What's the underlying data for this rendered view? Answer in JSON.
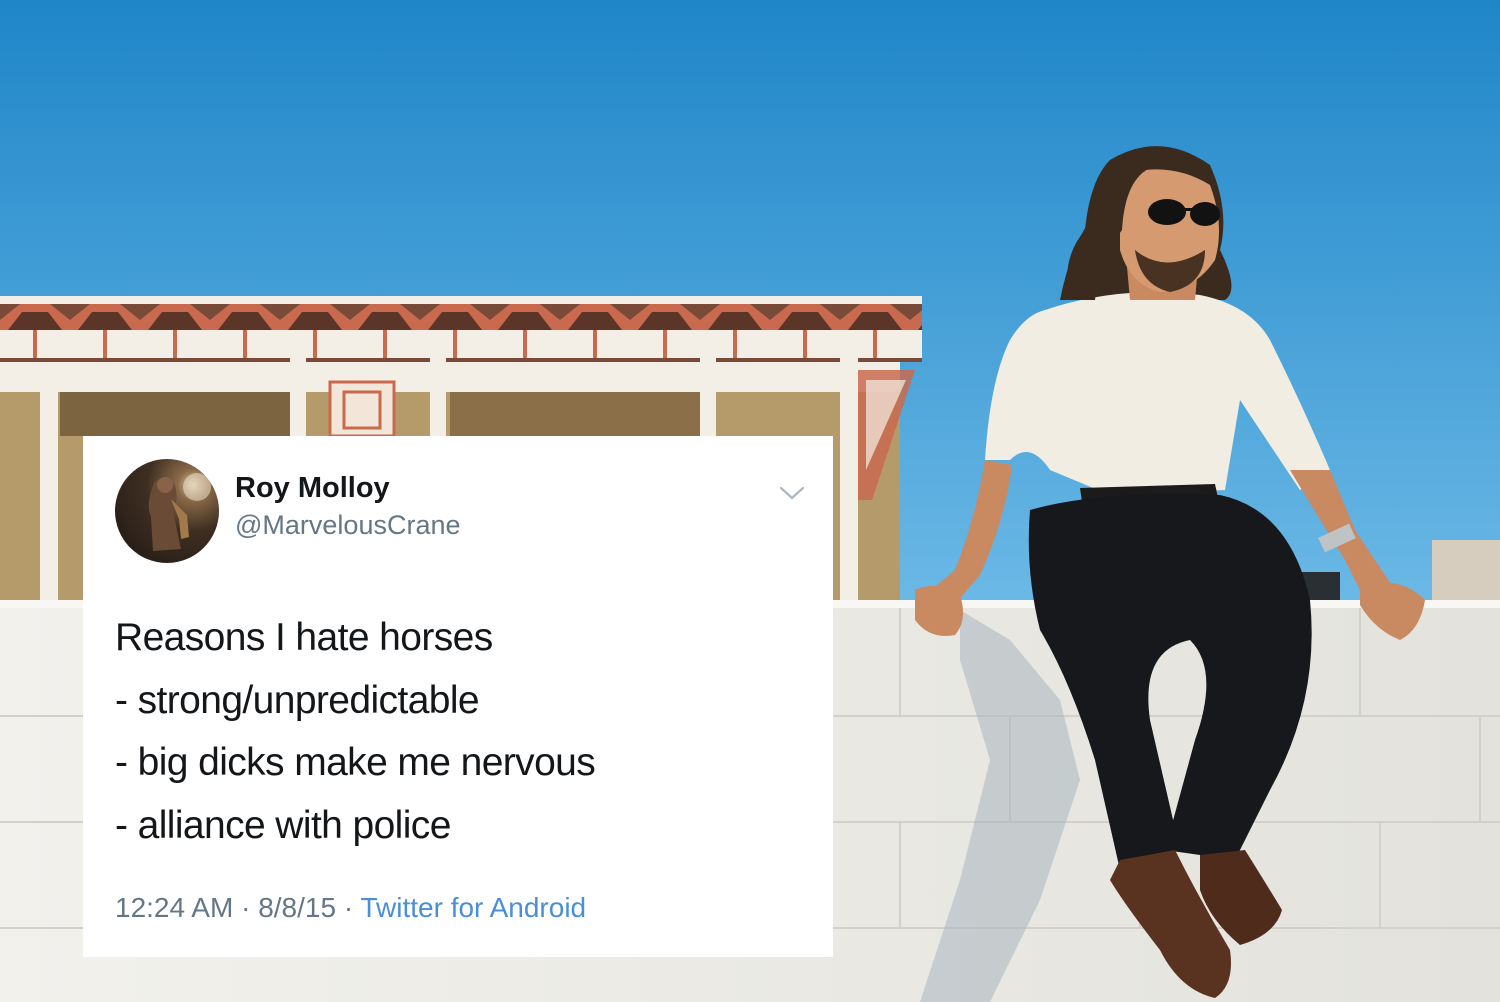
{
  "tweet": {
    "display_name": "Roy Molloy",
    "handle": "@MarvelousCrane",
    "lines": [
      "Reasons I hate horses",
      "- strong/unpredictable",
      "- big dicks make me nervous",
      "- alliance with police"
    ],
    "time": "12:24 AM",
    "date": "8/8/15",
    "separator": "·",
    "source": "Twitter for Android",
    "menu_icon": "chevron-down-icon",
    "avatar_icon": "profile-photo"
  },
  "colors": {
    "sky_top": "#1f86c8",
    "sky_bottom": "#66b6e4",
    "wall": "#ecebe6",
    "building_trim": "#c96a4f",
    "name_text": "#14171a",
    "muted_text": "#657786",
    "link": "#4a8fd6",
    "card_bg": "#ffffff"
  }
}
